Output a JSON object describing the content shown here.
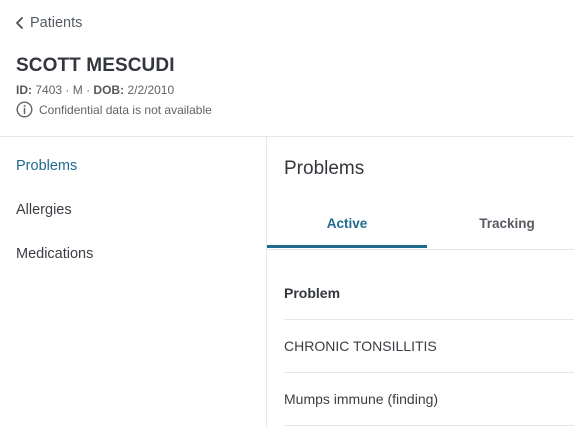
{
  "nav": {
    "back_label": "Patients"
  },
  "patient": {
    "name": "SCOTT MESCUDI",
    "id_label": "ID:",
    "id_value": "7403",
    "sex": "M",
    "dob_label": "DOB:",
    "dob_value": "2/2/2010",
    "separator": "·",
    "confidential_note": "Confidential data is not available"
  },
  "sidebar": {
    "items": [
      {
        "label": "Problems",
        "active": true
      },
      {
        "label": "Allergies",
        "active": false
      },
      {
        "label": "Medications",
        "active": false
      }
    ]
  },
  "main": {
    "title": "Problems",
    "tabs": [
      {
        "label": "Active",
        "active": true
      },
      {
        "label": "Tracking",
        "active": false
      }
    ],
    "table": {
      "header": "Problem",
      "rows": [
        "CHRONIC TONSILLITIS",
        "Mumps immune (finding)"
      ]
    }
  },
  "colors": {
    "accent": "#1f6a8e",
    "divider": "#e6e7e9",
    "text": "#33373c"
  },
  "icons": {
    "back": "chevron-left-icon",
    "info": "info-circle-icon"
  }
}
